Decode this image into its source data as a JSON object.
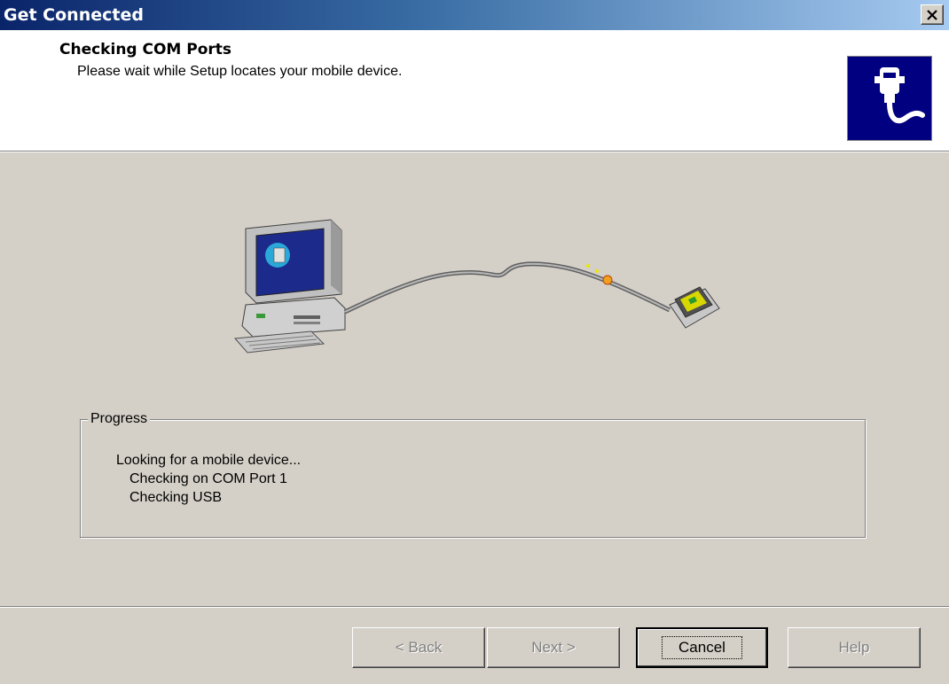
{
  "window": {
    "title": "Get Connected"
  },
  "header": {
    "title": "Checking COM Ports",
    "subtitle": "Please wait while Setup locates your mobile device.",
    "icon": "connector-cable-icon"
  },
  "illustration": {
    "computer_icon": "desktop-computer-icon",
    "cable_icon": "serial-cable-icon",
    "device_icon": "handheld-device-icon"
  },
  "progress": {
    "legend": "Progress",
    "lines": [
      "Looking for a mobile device...",
      "Checking on COM Port 1",
      "Checking USB"
    ]
  },
  "buttons": {
    "back": {
      "label": "< Back",
      "enabled": false
    },
    "next": {
      "label": "Next >",
      "enabled": false
    },
    "cancel": {
      "label": "Cancel",
      "enabled": true
    },
    "help": {
      "label": "Help",
      "enabled": false
    }
  },
  "colors": {
    "titlebar_start": "#0a246a",
    "titlebar_end": "#a6caf0",
    "face": "#d4d0c8",
    "icon_bg": "#000080"
  }
}
